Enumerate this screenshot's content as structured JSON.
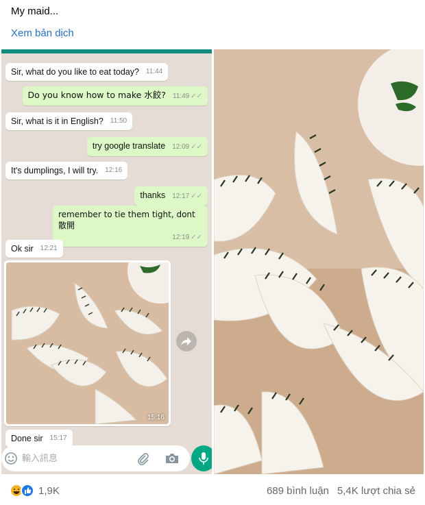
{
  "post": {
    "text": "My maid...",
    "translate_link": "Xem bản dịch"
  },
  "chat": {
    "messages": [
      {
        "direction": "in",
        "text": "Sir, what do you like to eat today?",
        "time": "11:44"
      },
      {
        "direction": "out",
        "text": "Do you know how to make 水餃?",
        "time": "11:49"
      },
      {
        "direction": "in",
        "text": "Sir, what is it in English?",
        "time": "11:50"
      },
      {
        "direction": "out",
        "text": "try google translate",
        "time": "12:09"
      },
      {
        "direction": "in",
        "text": "It's dumplings, I will try.",
        "time": "12:16"
      },
      {
        "direction": "out",
        "text": "thanks",
        "time": "12:17"
      },
      {
        "direction": "out",
        "text": "remember to tie them tight, dont 散開",
        "time": "12:19"
      },
      {
        "direction": "in",
        "text": "Ok sir",
        "time": "12:21"
      },
      {
        "direction": "in",
        "text": "Done sir",
        "time": "15:17"
      }
    ],
    "photo_time": "15:16",
    "input_placeholder": "輸入訊息",
    "icons": {
      "emoji": "emoji-icon",
      "attach": "paperclip-icon",
      "camera": "camera-icon",
      "mic": "microphone-icon",
      "forward": "forward-icon"
    }
  },
  "footer": {
    "reaction_count": "1,9K",
    "comments": "689 bình luận",
    "shares": "5,4K lượt chia sẻ",
    "reaction_icons": [
      "laugh-emoji-icon",
      "like-emoji-icon"
    ]
  },
  "colors": {
    "link": "#216fdb",
    "chat_background": "#e5ddd5",
    "outgoing_bubble": "#dcf8c6",
    "incoming_bubble": "#ffffff",
    "accent": "#00a884",
    "meta_text": "#65676b"
  }
}
